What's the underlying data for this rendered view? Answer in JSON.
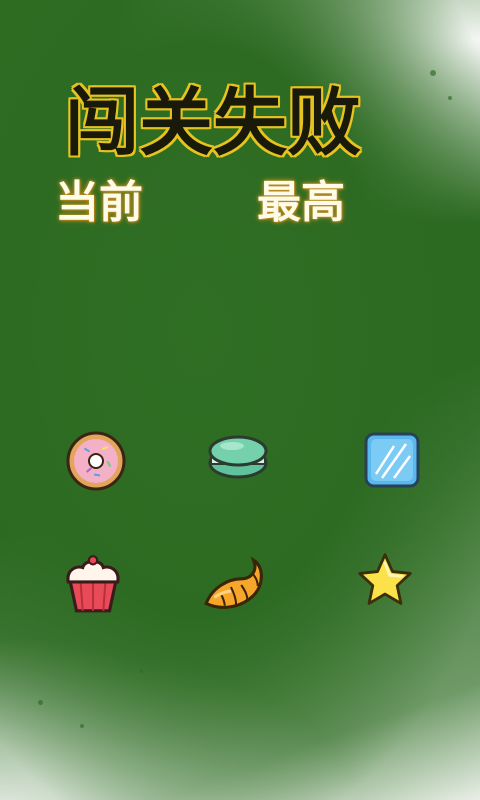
{
  "title": "闯关失败",
  "labels": {
    "current": "当前",
    "best": "最高"
  },
  "items": [
    {
      "icon": "donut-icon"
    },
    {
      "icon": "macaron-icon"
    },
    {
      "icon": "ice-cube-icon"
    },
    {
      "icon": "cupcake-icon"
    },
    {
      "icon": "croissant-icon"
    },
    {
      "icon": "star-icon"
    }
  ],
  "colors": {
    "background": "#2d6b22",
    "title_outline": "#e7c320"
  }
}
